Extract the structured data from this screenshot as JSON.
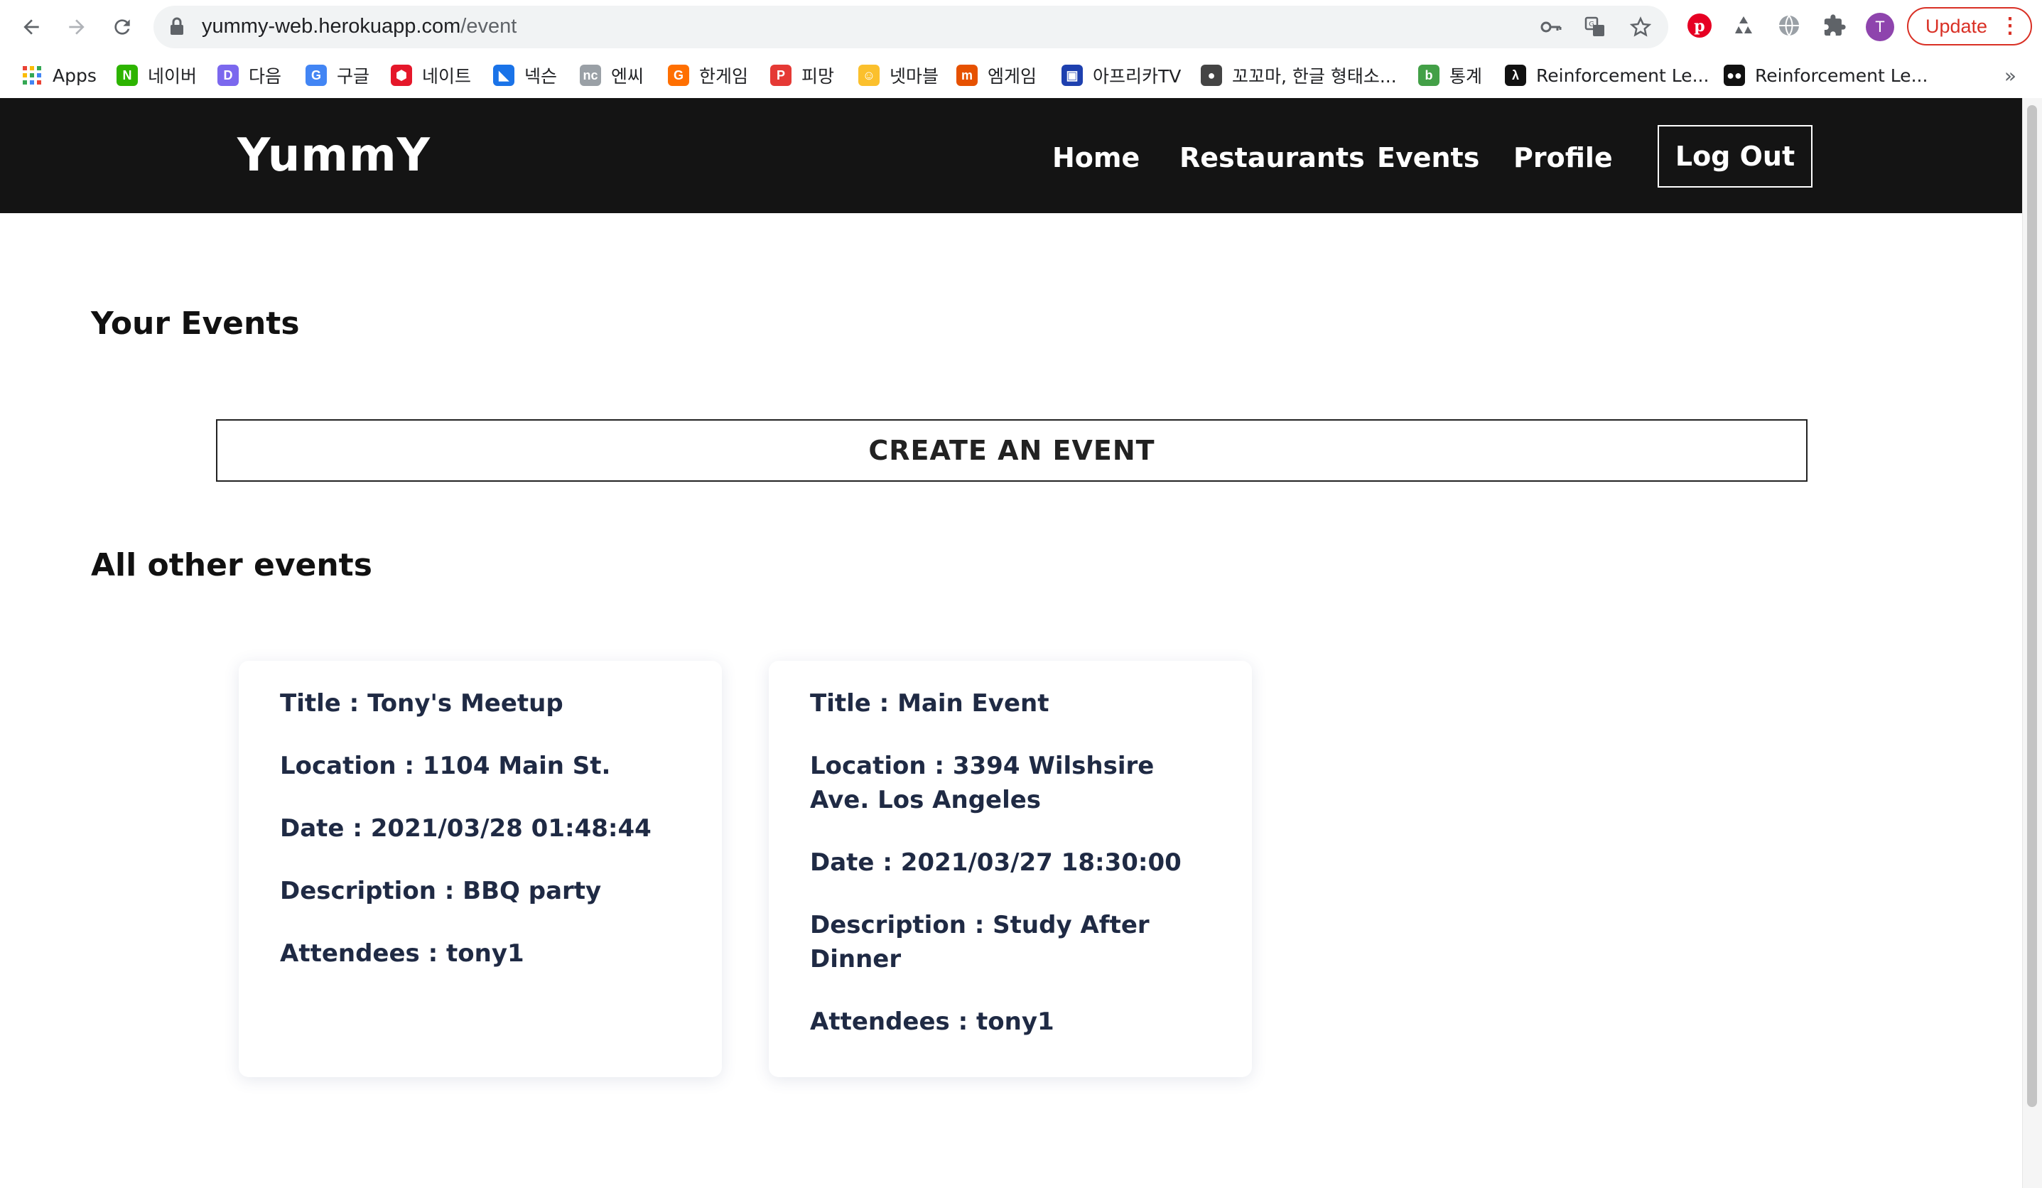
{
  "browser": {
    "url_host": "yummy-web.herokuapp.com",
    "url_path": "/event",
    "avatar_letter": "T",
    "update_label": "Update",
    "bookmarks": [
      {
        "label": "Apps",
        "icon": "apps-grid-icon",
        "color": "#ea4335"
      },
      {
        "label": "네이버",
        "icon": "naver-icon",
        "color": "#2db400",
        "glyph": "N"
      },
      {
        "label": "다음",
        "icon": "daum-icon",
        "color": "#7b68ee",
        "glyph": "D"
      },
      {
        "label": "구글",
        "icon": "google-icon",
        "color": "#4285f4",
        "glyph": "G"
      },
      {
        "label": "네이트",
        "icon": "nate-icon",
        "color": "#e5172a",
        "glyph": "⬢"
      },
      {
        "label": "넥슨",
        "icon": "nexon-icon",
        "color": "#1a73e8",
        "glyph": "◣"
      },
      {
        "label": "엔씨",
        "icon": "ncsoft-icon",
        "color": "#9aa0a6",
        "glyph": "nc"
      },
      {
        "label": "한게임",
        "icon": "hangame-icon",
        "color": "#ff6f00",
        "glyph": "G"
      },
      {
        "label": "피망",
        "icon": "pmang-icon",
        "color": "#e53935",
        "glyph": "P"
      },
      {
        "label": "넷마블",
        "icon": "netmarble-icon",
        "color": "#fbc02d",
        "glyph": "☺"
      },
      {
        "label": "엠게임",
        "icon": "mgame-icon",
        "color": "#e65100",
        "glyph": "m"
      },
      {
        "label": "아프리카TV",
        "icon": "afreecatv-icon",
        "color": "#1e40af",
        "glyph": "▣"
      },
      {
        "label": "꼬꼬마, 한글 형태소...",
        "icon": "globe-icon",
        "color": "#444444",
        "glyph": "●"
      },
      {
        "label": "통계",
        "icon": "blog-icon",
        "color": "#43a047",
        "glyph": "b"
      },
      {
        "label": "Reinforcement Le...",
        "icon": "lambda-icon",
        "color": "#111111",
        "glyph": "λ"
      },
      {
        "label": "Reinforcement Le...",
        "icon": "medium-icon",
        "color": "#111111",
        "glyph": "●●"
      }
    ]
  },
  "header": {
    "brand": "YummY",
    "nav": [
      "Home",
      "Restaurants",
      "Events",
      "Profile"
    ],
    "logout": "Log Out"
  },
  "main": {
    "your_events_title": "Your Events",
    "create_button": "CREATE AN EVENT",
    "other_events_title": "All other events",
    "events": [
      {
        "title": "Title : Tony's Meetup",
        "location": "Location : 1104 Main St.",
        "date": "Date : 2021/03/28 01:48:44",
        "description": "Description : BBQ party",
        "attendees": "Attendees : tony1"
      },
      {
        "title": "Title : Main Event",
        "location": "Location : 3394 Wilshsire Ave. Los Angeles",
        "date": "Date : 2021/03/27 18:30:00",
        "description": "Description : Study After Dinner",
        "attendees": "Attendees : tony1"
      }
    ]
  }
}
